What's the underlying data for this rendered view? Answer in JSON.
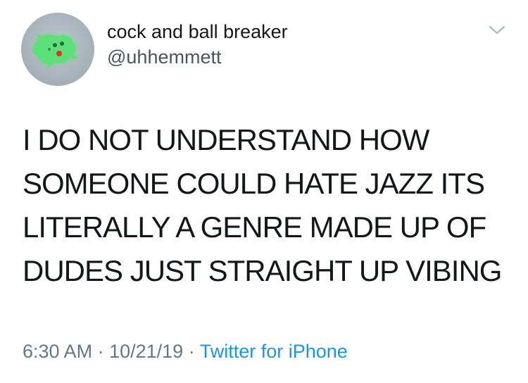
{
  "tweet": {
    "user": {
      "display_name": "cock and ball breaker",
      "handle": "@uhhemmett"
    },
    "text_lines": [
      "I DO NOT UNDERSTAND HOW",
      "SOMEONE COULD HATE JAZZ ITS",
      "LITERALLY A GENRE MADE UP OF",
      "DUDES JUST STRAIGHT UP VIBING"
    ],
    "meta": {
      "time": "6:30 AM",
      "separator": "·",
      "date": "10/21/19",
      "source": "Twitter for iPhone"
    }
  },
  "colors": {
    "text": "#14171a",
    "secondary": "#657786",
    "link": "#1b95e0",
    "avatar_creature": "#5de07a"
  },
  "icons": {
    "menu": "chevron-down-icon"
  }
}
